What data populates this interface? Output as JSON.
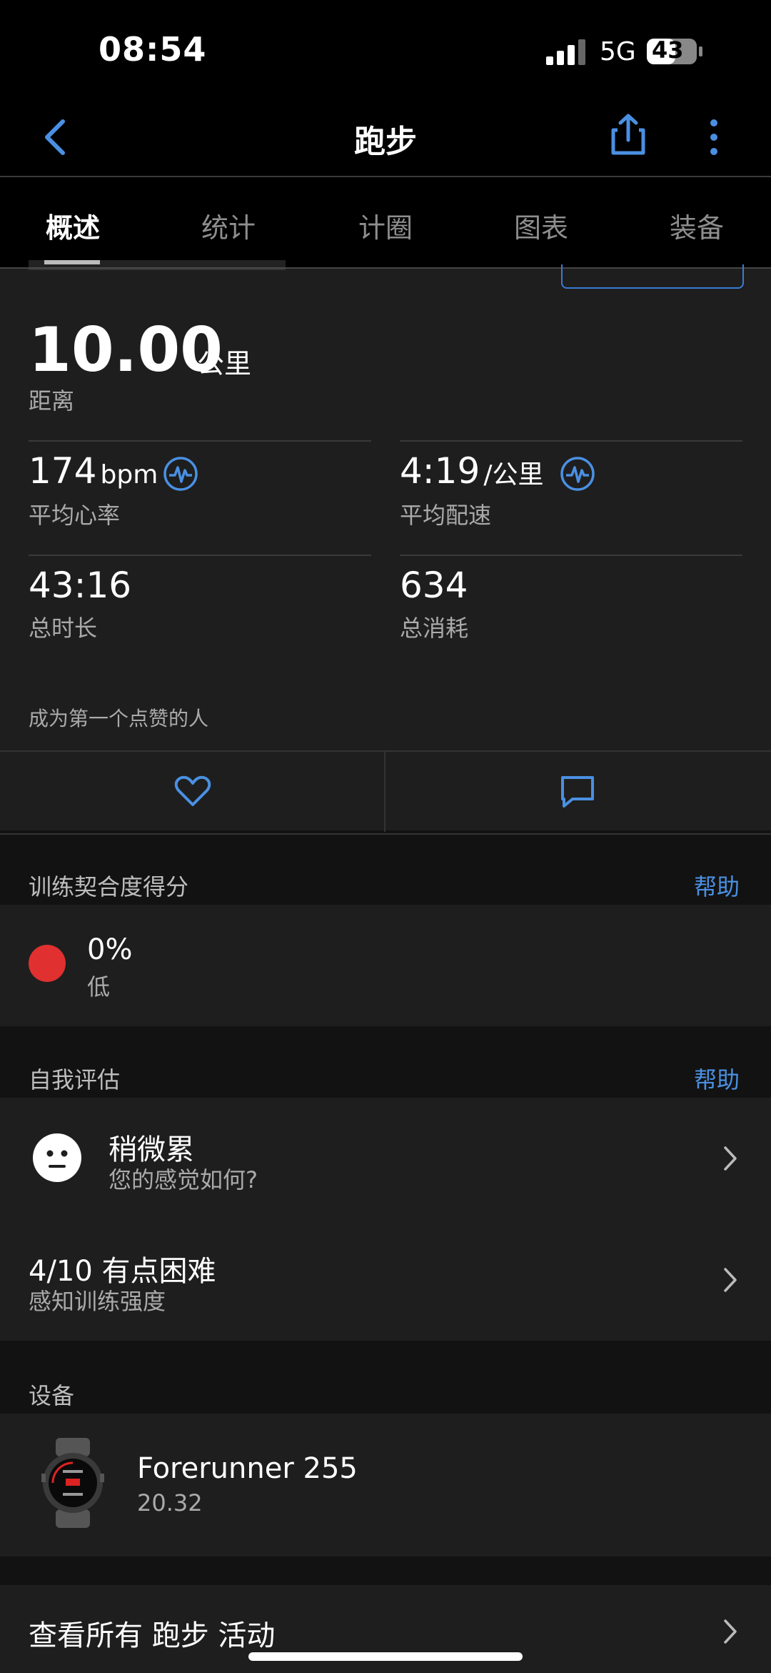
{
  "status": {
    "time": "08:54",
    "network": "5G",
    "battery": "43"
  },
  "nav": {
    "title": "跑步"
  },
  "tabs": [
    {
      "label": "概述"
    },
    {
      "label": "统计"
    },
    {
      "label": "计圈"
    },
    {
      "label": "图表"
    },
    {
      "label": "装备"
    }
  ],
  "summary": {
    "distance_value": "10.00",
    "distance_unit": "公里",
    "distance_label": "距离",
    "heart_rate": {
      "value": "174",
      "unit": "bpm",
      "label": "平均心率"
    },
    "pace": {
      "value": "4:19",
      "unit": "/公里",
      "label": "平均配速"
    },
    "duration": {
      "value": "43:16",
      "label": "总时长"
    },
    "calories": {
      "value": "634",
      "label": "总消耗"
    },
    "like_prompt": "成为第一个点赞的人"
  },
  "training_score": {
    "title": "训练契合度得分",
    "help": "帮助",
    "value": "0%",
    "level": "低",
    "dot_color": "#e03030"
  },
  "self_eval": {
    "title": "自我评估",
    "help": "帮助",
    "feeling": "稍微累",
    "feeling_sub": "您的感觉如何?",
    "intensity": "4/10 有点困难",
    "intensity_sub": "感知训练强度"
  },
  "device": {
    "title": "设备",
    "name": "Forerunner 255",
    "version": "20.32"
  },
  "view_all": "查看所有 跑步 活动",
  "colors": {
    "accent": "#4a90e2",
    "background": "#121212",
    "card": "#1e1e1e"
  }
}
